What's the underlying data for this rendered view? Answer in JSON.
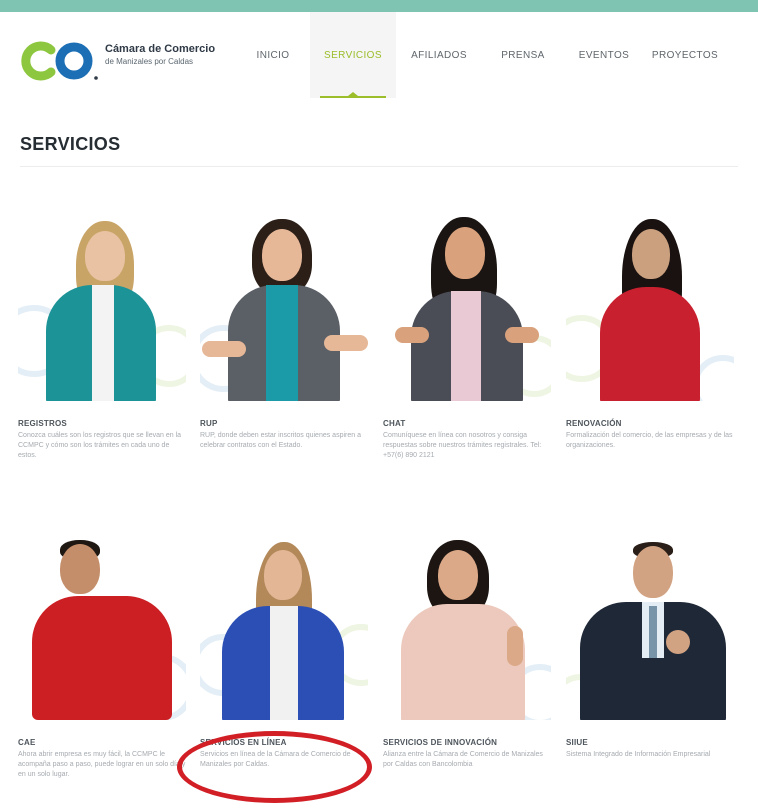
{
  "brand": {
    "name": "Cámara de Comercio",
    "subtitle": "de Manizales por Caldas",
    "colors": {
      "logo_green": "#8dc63f",
      "logo_blue": "#1d6fb5"
    }
  },
  "nav": {
    "items": [
      "INICIO",
      "SERVICIOS",
      "AFILIADOS",
      "PRENSA",
      "EVENTOS",
      "PROYECTOS"
    ],
    "active": "SERVICIOS",
    "active_color": "#9bbe2a"
  },
  "page": {
    "title": "SERVICIOS"
  },
  "services": [
    {
      "title": "REGISTROS",
      "description": "Conozca cuáles son los registros que se llevan en la CCMPC y cómo son los trámites en cada uno de estos."
    },
    {
      "title": "RUP",
      "description": "RUP, donde deben estar inscritos quienes aspiren a celebrar contratos con el Estado."
    },
    {
      "title": "CHAT",
      "description": "Comuníquese en línea con nosotros y consiga respuestas sobre nuestros trámites registrales. Tel: +57(6) 890 2121"
    },
    {
      "title": "RENOVACIÓN",
      "description": "Formalización del comercio, de las empresas y de las organizaciones."
    },
    {
      "title": "CAE",
      "description": "Ahora abrir empresa es muy fácil, la CCMPC le acompaña paso a paso, puede lograr en un solo día y en un solo lugar."
    },
    {
      "title": "SERVICIOS EN LÍNEA",
      "description": "Servicios en línea de la Cámara de Comercio de Manizales por Caldas."
    },
    {
      "title": "SERVICIOS DE INNOVACIÓN",
      "description": "Alianza entre la Cámara de Comercio de Manizales por Caldas con Bancolombia"
    },
    {
      "title": "SIIUE",
      "description": "Sistema Integrado de Información Empresarial"
    }
  ],
  "annotation": {
    "highlighted_item": "SERVICIOS EN LÍNEA",
    "color": "#d21f26"
  }
}
